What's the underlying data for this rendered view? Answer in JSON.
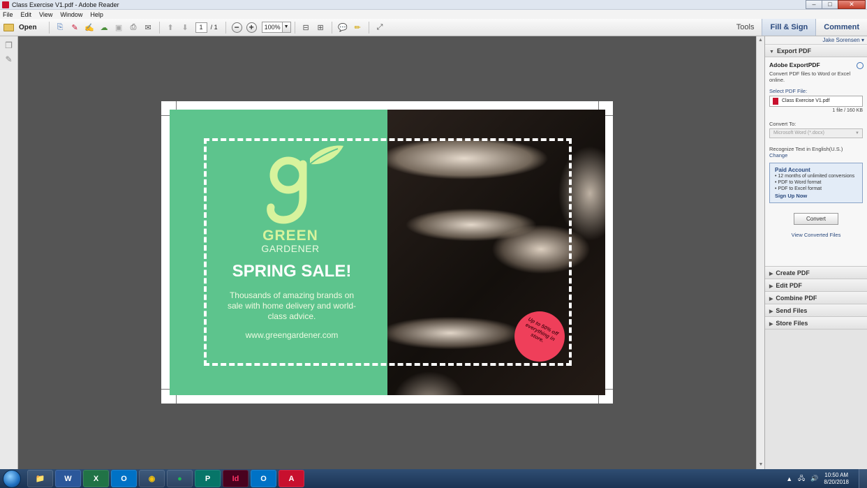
{
  "window": {
    "title": "Class Exercise V1.pdf - Adobe Reader",
    "min": "–",
    "max": "□",
    "close": "✕"
  },
  "menu": [
    "File",
    "Edit",
    "View",
    "Window",
    "Help"
  ],
  "toolbar": {
    "open_label": "Open",
    "page_current": "1",
    "page_total": "/ 1",
    "zoom": "100%",
    "tabs": {
      "tools": "Tools",
      "fill_sign": "Fill & Sign",
      "comment": "Comment"
    }
  },
  "flyer": {
    "brand_line1": "GREEN",
    "brand_line2": "GARDENER",
    "headline": "SPRING SALE!",
    "description": "Thousands of amazing brands on sale with home delivery and world-class advice.",
    "url": "www.greengardener.com",
    "badge": "Up to 50% off everything in store.",
    "colors": {
      "green": "#5dc48d",
      "lime": "#d7f39d",
      "badge": "#ef3f5a"
    }
  },
  "panel": {
    "user": "Jake Sorensen",
    "export_header": "Export PDF",
    "export_title": "Adobe ExportPDF",
    "export_desc": "Convert PDF files to Word or Excel online.",
    "select_label": "Select PDF File:",
    "file_name": "Class Exercise V1.pdf",
    "file_size": "1 file / 160 KB",
    "convert_to_label": "Convert To:",
    "convert_to_value": "Microsoft Word (*.docx)",
    "recognize": "Recognize Text in English(U.S.)",
    "change": "Change",
    "paid_title": "Paid Account",
    "paid_items": [
      "• 12 months of unlimited conversions",
      "• PDF to Word format",
      "• PDF to Excel format"
    ],
    "signup": "Sign Up Now",
    "convert_btn": "Convert",
    "view_converted": "View Converted Files",
    "sections": [
      "Create PDF",
      "Edit PDF",
      "Combine PDF",
      "Send Files",
      "Store Files"
    ]
  },
  "taskbar": {
    "apps": [
      {
        "name": "explorer",
        "glyph": "📁"
      },
      {
        "name": "word",
        "glyph": "W"
      },
      {
        "name": "excel",
        "glyph": "X"
      },
      {
        "name": "outlook",
        "glyph": "O"
      },
      {
        "name": "chrome",
        "glyph": "◉"
      },
      {
        "name": "spotify",
        "glyph": "●"
      },
      {
        "name": "publisher",
        "glyph": "P"
      },
      {
        "name": "indesign",
        "glyph": "Id"
      },
      {
        "name": "outlook2",
        "glyph": "O"
      },
      {
        "name": "acrobat",
        "glyph": "A"
      }
    ],
    "time": "10:50 AM",
    "date": "8/20/2018"
  }
}
